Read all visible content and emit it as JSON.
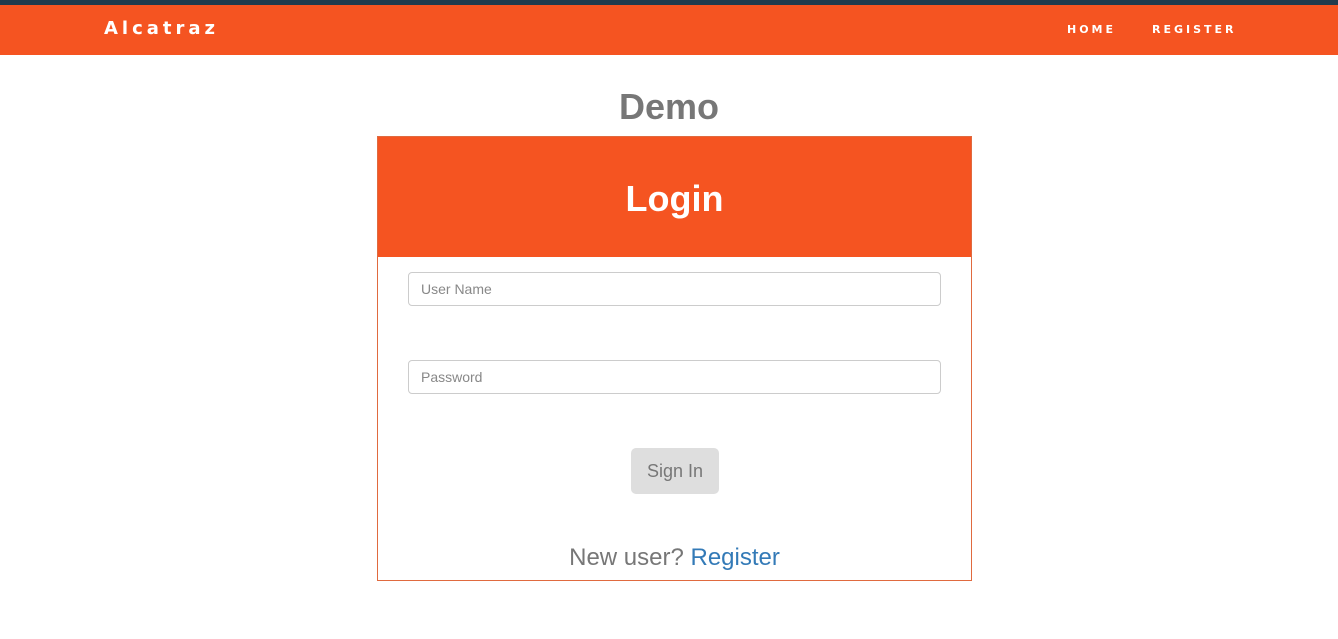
{
  "navbar": {
    "brand": "Alcatraz",
    "links": [
      {
        "label": "HOME"
      },
      {
        "label": "REGISTER"
      }
    ]
  },
  "page": {
    "title": "Demo"
  },
  "login": {
    "title": "Login",
    "username_placeholder": "User Name",
    "password_placeholder": "Password",
    "signin_label": "Sign In",
    "new_user_text": "New user?",
    "register_link": "Register"
  },
  "colors": {
    "brand": "#f55421",
    "topbar": "#1f3b4d",
    "link": "#337ab7"
  }
}
